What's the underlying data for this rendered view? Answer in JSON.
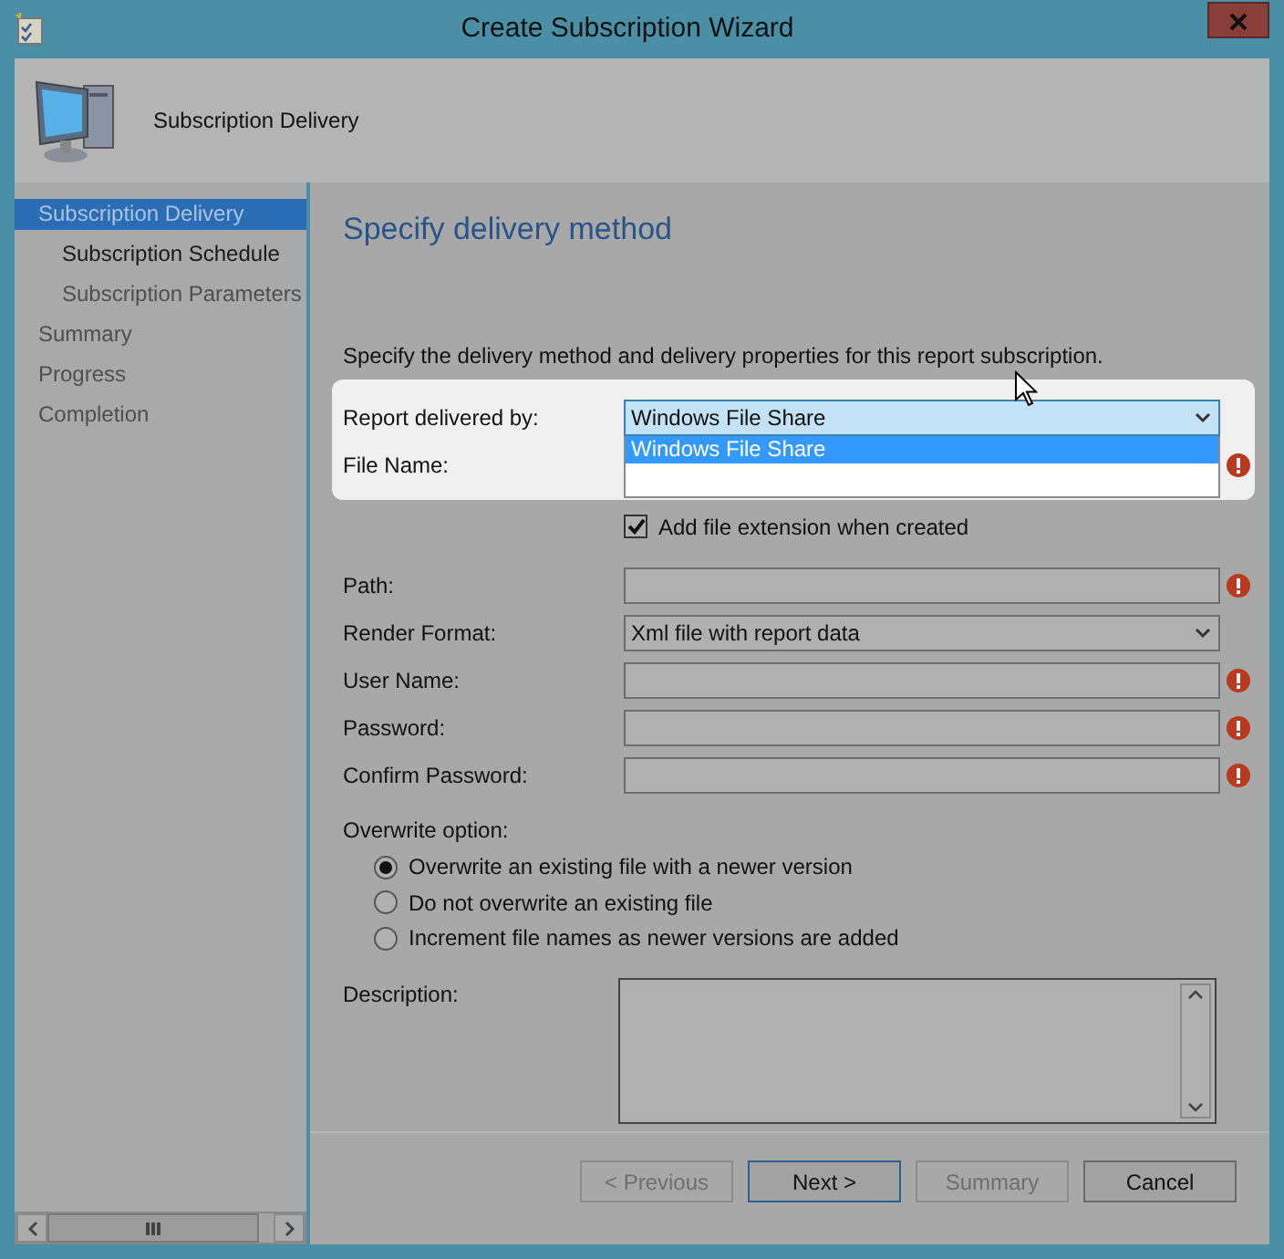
{
  "window": {
    "title": "Create Subscription Wizard"
  },
  "header": {
    "title": "Subscription Delivery"
  },
  "sidebar": {
    "items": [
      {
        "label": "Subscription Delivery",
        "selected": true,
        "children": [
          {
            "label": "Subscription Schedule",
            "selected": false,
            "disabled": false
          },
          {
            "label": "Subscription Parameters",
            "selected": false,
            "disabled": true
          }
        ]
      },
      {
        "label": "Summary",
        "selected": false,
        "disabled": true
      },
      {
        "label": "Progress",
        "selected": false,
        "disabled": true
      },
      {
        "label": "Completion",
        "selected": false,
        "disabled": true
      }
    ]
  },
  "page": {
    "heading": "Specify delivery method",
    "intro": "Specify the delivery method and delivery properties for this report subscription.",
    "delivery": {
      "label": "Report delivered by:",
      "value": "Windows File Share",
      "expanded": true,
      "options": [
        {
          "label": "Windows File Share",
          "selected": true
        }
      ]
    },
    "file_name": {
      "label": "File Name:",
      "required": true
    },
    "add_extension": {
      "label": "Add file extension when created",
      "checked": true
    },
    "fields": [
      {
        "kind": "text",
        "label": "Path:",
        "required": true
      },
      {
        "kind": "dropdown",
        "label": "Render Format:",
        "value": "Xml file with report data"
      },
      {
        "kind": "text",
        "label": "User Name:",
        "required": true
      },
      {
        "kind": "text",
        "label": "Password:",
        "required": true
      },
      {
        "kind": "text",
        "label": "Confirm Password:",
        "required": true
      }
    ],
    "overwrite": {
      "label": "Overwrite option:",
      "options": [
        {
          "label": "Overwrite an existing file with a newer version",
          "selected": true
        },
        {
          "label": "Do not overwrite an existing file",
          "selected": false
        },
        {
          "label": "Increment file names as newer versions are added",
          "selected": false
        }
      ]
    },
    "description": {
      "label": "Description:"
    }
  },
  "buttons": [
    {
      "label": "< Previous",
      "disabled": true,
      "default": false
    },
    {
      "label": "Next >",
      "disabled": false,
      "default": true
    },
    {
      "label": "Summary",
      "disabled": true,
      "default": false
    },
    {
      "label": "Cancel",
      "disabled": false,
      "default": false
    }
  ]
}
